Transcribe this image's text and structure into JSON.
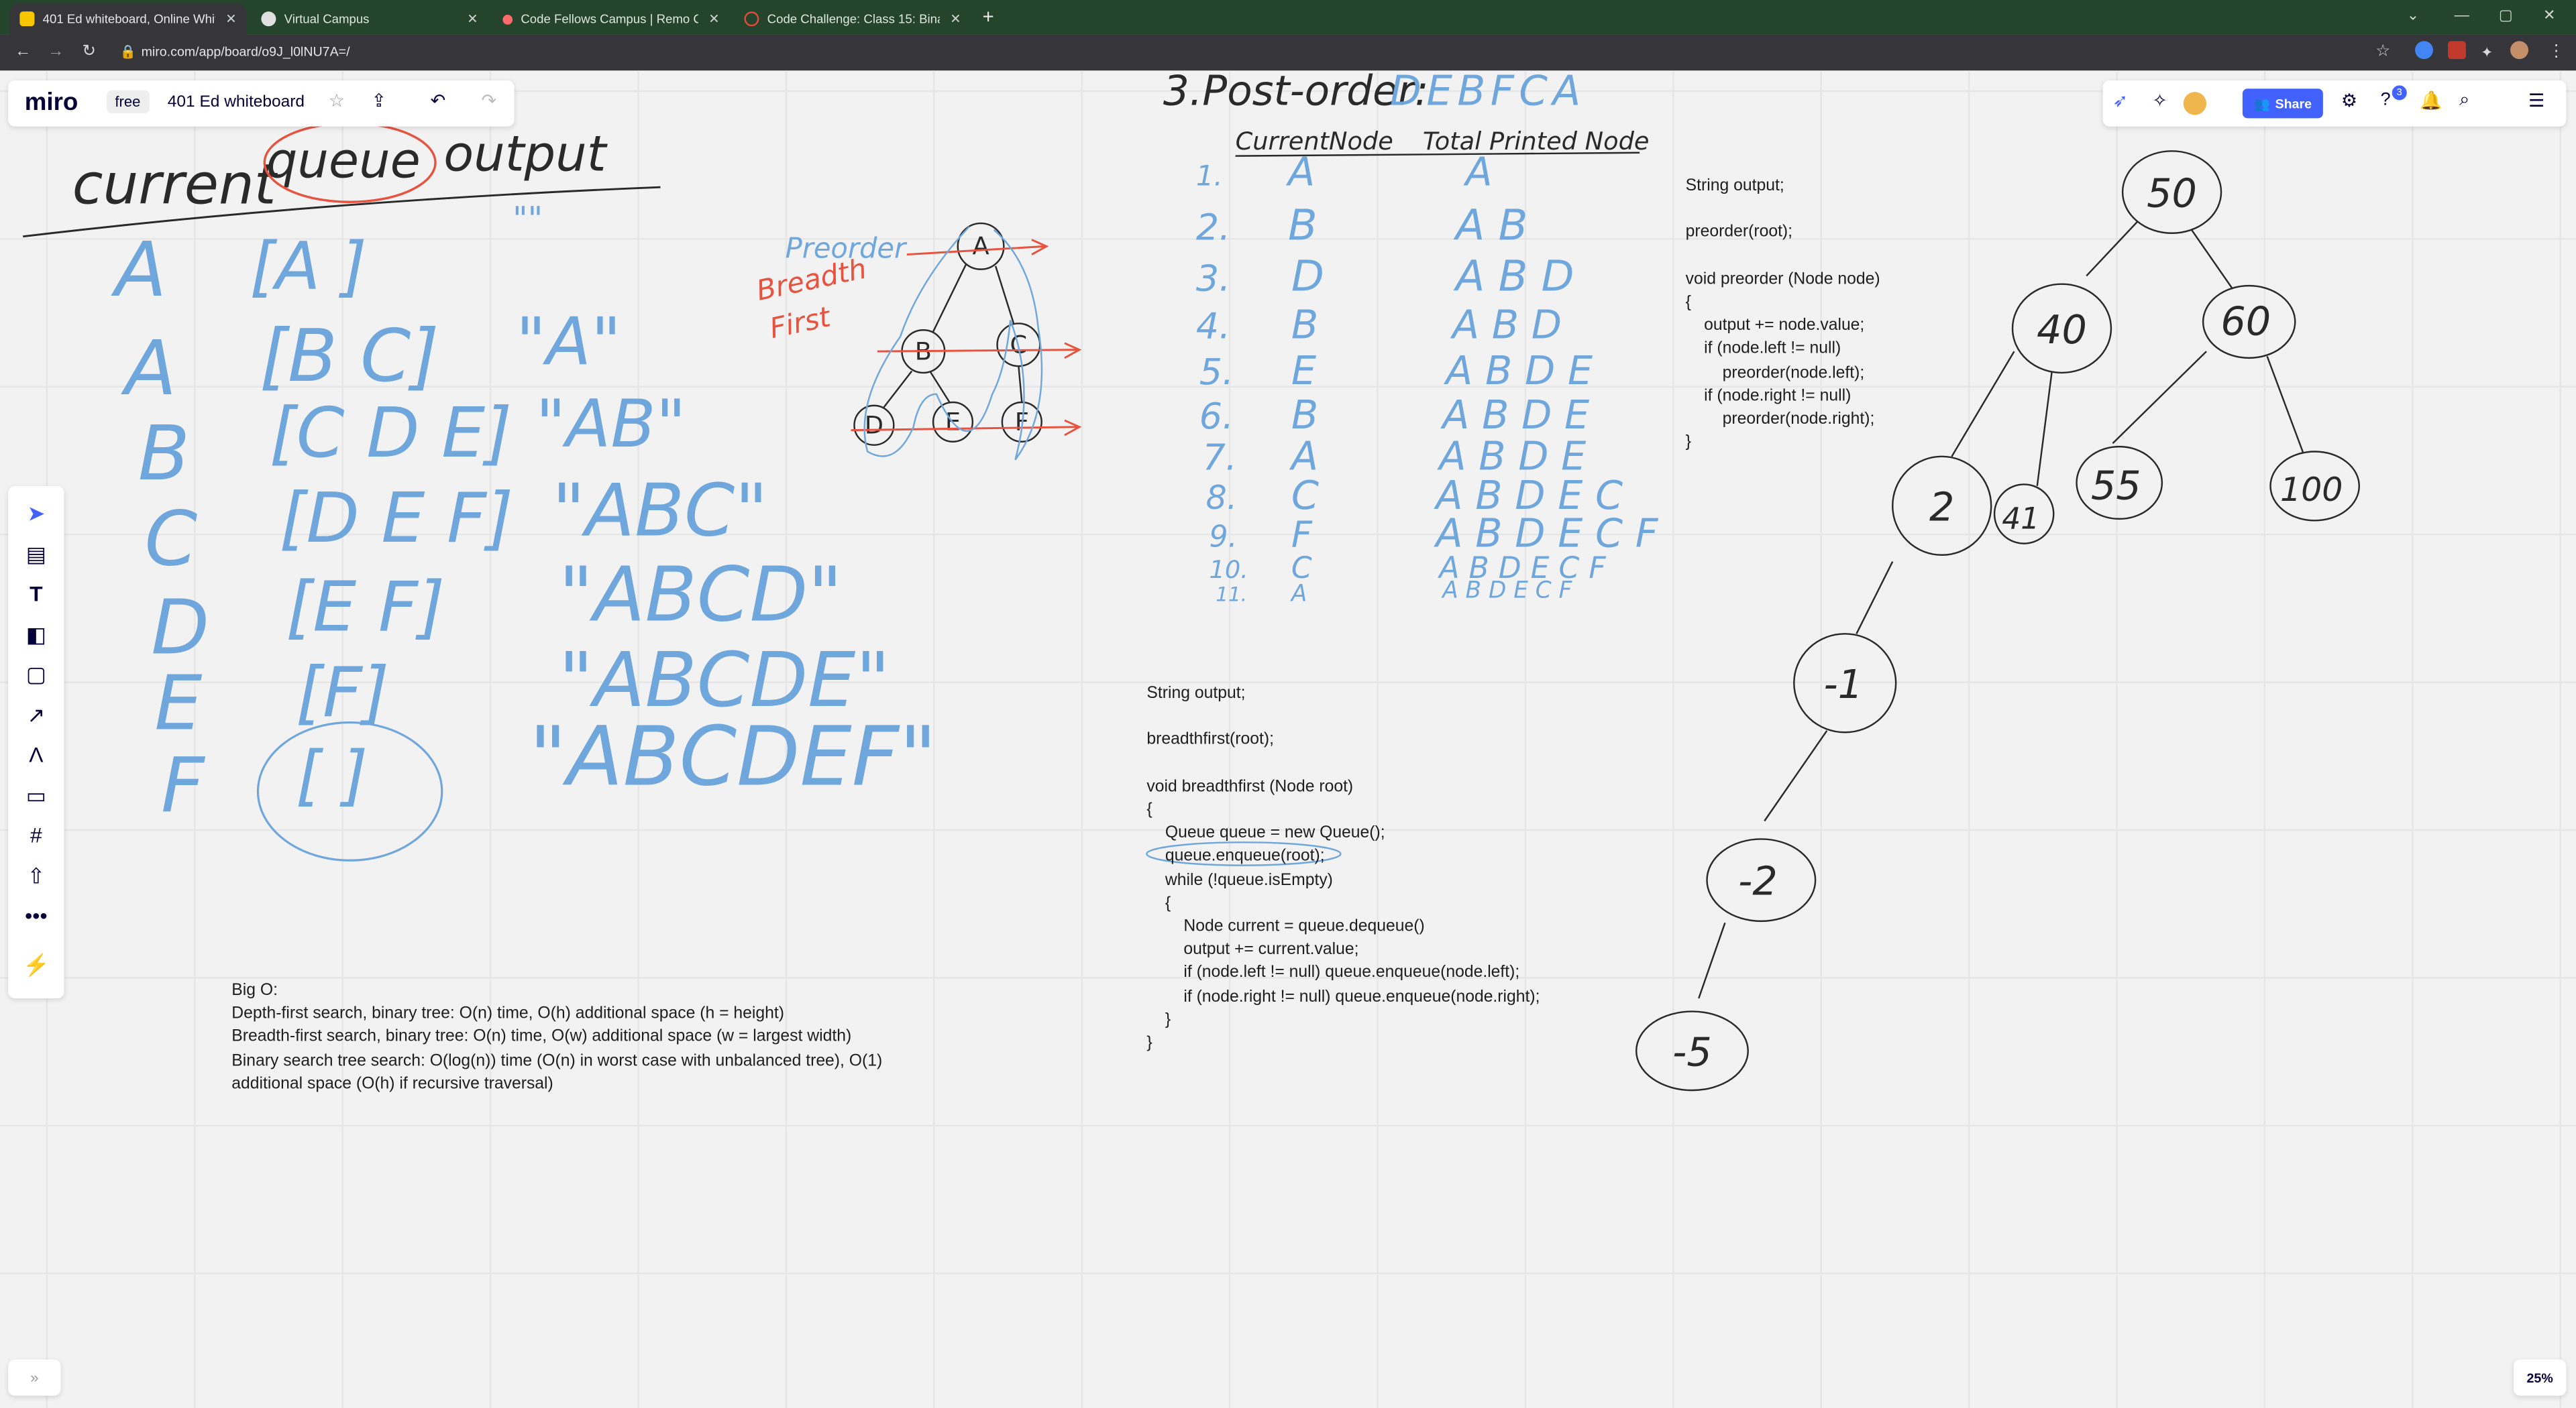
{
  "browser": {
    "tabs": [
      {
        "label": "401 Ed whiteboard, Online White"
      },
      {
        "label": "Virtual Campus"
      },
      {
        "label": "Code Fellows Campus | Remo Co"
      },
      {
        "label": "Code Challenge: Class 15: Binary"
      }
    ],
    "url": "miro.com/app/board/o9J_l0lNU7A=/",
    "colors": {
      "tab_bar": "#24442b",
      "address_bar": "#35353a"
    }
  },
  "miro": {
    "logo": "miro",
    "plan_badge": "free",
    "board_title": "401 Ed whiteboard",
    "share_label": "Share",
    "notification_count": "3",
    "zoom_level": "25%",
    "accent": "#4262ff",
    "toolbar_tools": [
      "select",
      "templates",
      "text",
      "sticky-note",
      "shape",
      "connection-line",
      "pen",
      "comment",
      "frame",
      "upload",
      "more",
      "apps"
    ]
  },
  "board": {
    "preorder_code": [
      "String output;",
      "",
      "preorder(root);",
      "",
      "void preorder (Node node)",
      "{",
      "    output += node.value;",
      "    if (node.left != null)",
      "        preorder(node.left);",
      "    if (node.right != null)",
      "        preorder(node.right);",
      "}"
    ],
    "breadthfirst_code": [
      "String output;",
      "",
      "breadthfirst(root);",
      "",
      "void breadthfirst (Node root)",
      "{",
      "    Queue queue = new Queue();",
      "    queue.enqueue(root);",
      "    while (!queue.isEmpty)",
      "    {",
      "        Node current = queue.dequeue()",
      "        output += current.value;",
      "        if (node.left != null) queue.enqueue(node.left);",
      "        if (node.right != null) queue.enqueue(node.right);",
      "    }",
      "}"
    ],
    "big_o": [
      "Big O:",
      "Depth-first search, binary tree: O(n) time, O(h) additional space (h = height)",
      "Breadth-first search, binary tree: O(n) time, O(w) additional space (w = largest width)",
      "Binary search tree search: O(log(n)) time (O(n) in worst case with unbalanced tree), O(1)",
      "additional space (O(h) if recursive traversal)"
    ],
    "handwriting": {
      "header": {
        "current": "current",
        "queue": "queue",
        "output": "output"
      },
      "bfs_rows": [
        {
          "current": "A",
          "queue": "[A ]",
          "output": "\"\""
        },
        {
          "current": "A",
          "queue": "[B C]",
          "output": "\"A\""
        },
        {
          "current": "B",
          "queue": "[C D E]",
          "output": "\"AB\""
        },
        {
          "current": "C",
          "queue": "[D E F]",
          "output": "\"ABC\""
        },
        {
          "current": "D",
          "queue": "[E F]",
          "output": "\"ABCD\""
        },
        {
          "current": "E",
          "queue": "[F]",
          "output": "\"ABCDE\""
        },
        {
          "current": "F",
          "queue": "[ ]",
          "output": "\"ABCDEF\""
        }
      ],
      "preorder_word": "Preorder",
      "breadth_word": "Breadth",
      "first_word": "First",
      "small_tree_nodes": [
        "A",
        "B",
        "C",
        "D",
        "E",
        "F"
      ],
      "postorder_title": "3.Post-order:",
      "postorder_sequence": "DEBFCA",
      "trace_headers": {
        "node": "CurrentNode",
        "printed": "Total Printed Node"
      },
      "trace_rows": [
        {
          "n": "1.",
          "node": "A",
          "printed": "A"
        },
        {
          "n": "2.",
          "node": "B",
          "printed": "A B"
        },
        {
          "n": "3.",
          "node": "D",
          "printed": "A B D"
        },
        {
          "n": "4.",
          "node": "B",
          "printed": "A B D"
        },
        {
          "n": "5.",
          "node": "E",
          "printed": "A B D E"
        },
        {
          "n": "6.",
          "node": "B",
          "printed": "A B D E"
        },
        {
          "n": "7.",
          "node": "A",
          "printed": "A B D E"
        },
        {
          "n": "8.",
          "node": "C",
          "printed": "A B D E C"
        },
        {
          "n": "9.",
          "node": "F",
          "printed": "A B D E C F"
        },
        {
          "n": "10.",
          "node": "C",
          "printed": "A B D E C F"
        },
        {
          "n": "11.",
          "node": "A",
          "printed": "A B D E C F"
        }
      ],
      "bst_nodes": [
        "50",
        "40",
        "60",
        "2",
        "41",
        "55",
        "100",
        "-1",
        "-2",
        "-5"
      ]
    },
    "ink_colors": {
      "blue": "#6fa7dc",
      "red": "#e8533f",
      "black": "#2a2a2a"
    }
  }
}
